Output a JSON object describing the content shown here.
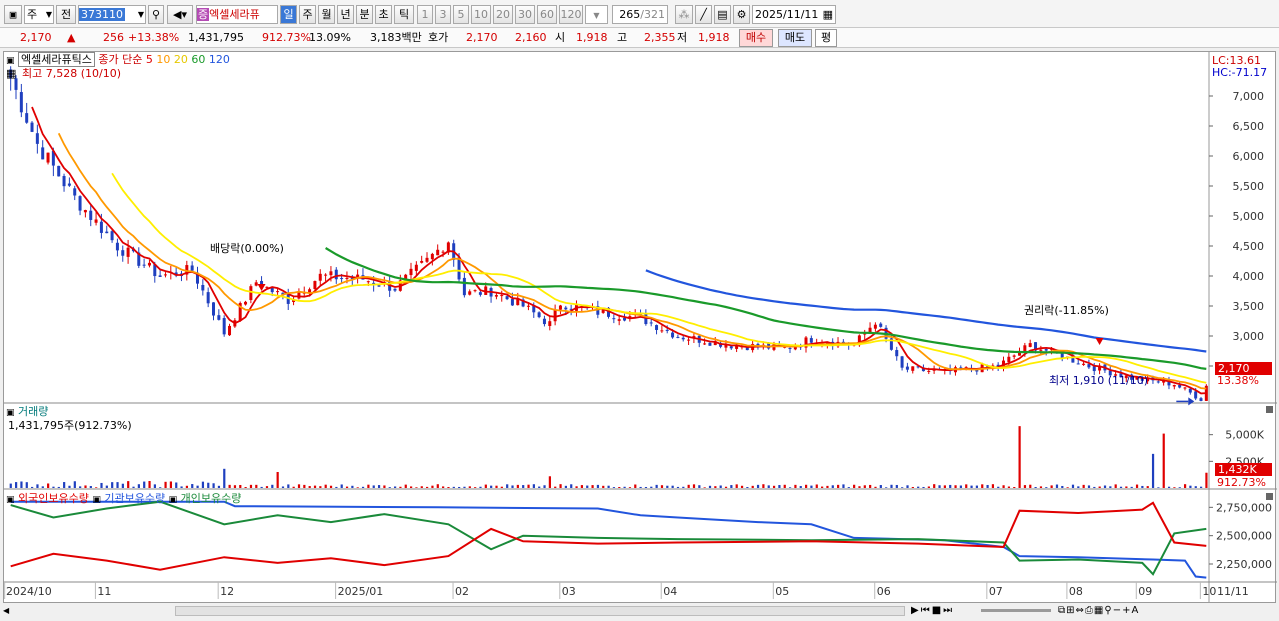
{
  "toolbar": {
    "period_select": "주",
    "prev_label": "전",
    "code": "373110",
    "stock_name": "엑셀세라퓨",
    "stock_tag": "증",
    "period_tabs": [
      "일",
      "주",
      "월",
      "년",
      "분",
      "초",
      "틱"
    ],
    "active_tab": "일",
    "interval_buttons": [
      "1",
      "3",
      "5",
      "10",
      "20",
      "30",
      "60",
      "120"
    ],
    "count_shown": "265",
    "count_total": "/321",
    "date": "2025/11/11"
  },
  "quote": {
    "price": "2,170",
    "change_arrow": "▲",
    "change": "256",
    "change_pct": "+13.38%",
    "volume": "1,431,795",
    "volume_ratio": "912.73%",
    "turnover": "13.09%",
    "amount": "3,183백만",
    "hoga_label": "호가",
    "ask": "2,170",
    "bid": "2,160",
    "open_label": "시",
    "open": "1,918",
    "high_label": "고",
    "high": "2,355",
    "low_label": "저",
    "low": "1,918",
    "buy_label": "매수",
    "sell_label": "매도",
    "eval_label": "평"
  },
  "chart_legend": {
    "name": "엑셀세라퓨틱스",
    "ma_label": "종가 단순",
    "ma_periods": [
      "5",
      "10",
      "20",
      "60",
      "120"
    ],
    "ma_colors": [
      "#e00000",
      "#ff9900",
      "#ffee00",
      "#1a9a2a",
      "#2255dd"
    ],
    "high_note": "최고 7,528 (10/10)",
    "low_note": "최저 1,910 (11/10)",
    "dividend_note": "배당락(0.00%)",
    "rights_note": "권리락(-11.85%)",
    "lc": "LC:13.61",
    "hc": "HC:-71.17",
    "last_price_tag": "2,170",
    "last_pct_tag": "13.38%"
  },
  "volume_panel": {
    "title": "거래량",
    "info": "1,431,795주(912.73%)",
    "last_tag": "1,432K",
    "last_pct": "912.73%"
  },
  "holdings_panel": {
    "legend": [
      "외국인보유수량",
      "기관보유수량",
      "개인보유수량"
    ],
    "colors": [
      "#e00000",
      "#2255dd",
      "#1a8a3a"
    ]
  },
  "x_axis": [
    "2024/10",
    "11",
    "12",
    "2025/01",
    "02",
    "03",
    "04",
    "05",
    "06",
    "07",
    "08",
    "09",
    "10",
    "11",
    "11/11"
  ],
  "colors": {
    "up": "#e00000",
    "down": "#1f3fbf",
    "axis_bg": "#ffffff",
    "active_tab": "#3a78d6"
  },
  "chart_data": [
    {
      "type": "candlestick",
      "title": "엑셀세라퓨틱스",
      "x_range": [
        "2024/10/08",
        "2025/11/11"
      ],
      "ylim": [
        1900,
        7600
      ],
      "y_ticks": [
        2500,
        3000,
        3500,
        4000,
        4500,
        5000,
        5500,
        6000,
        6500,
        7000
      ],
      "close_path": [
        [
          0,
          7300
        ],
        [
          5,
          6200
        ],
        [
          12,
          5300
        ],
        [
          20,
          4500
        ],
        [
          28,
          4000
        ],
        [
          34,
          4100
        ],
        [
          40,
          3050
        ],
        [
          46,
          3900
        ],
        [
          52,
          3600
        ],
        [
          58,
          4000
        ],
        [
          66,
          3950
        ],
        [
          72,
          3800
        ],
        [
          78,
          4250
        ],
        [
          82,
          4600
        ],
        [
          85,
          3700
        ],
        [
          90,
          3750
        ],
        [
          96,
          3500
        ],
        [
          101,
          3200
        ],
        [
          103,
          3550
        ],
        [
          110,
          3400
        ],
        [
          118,
          3300
        ],
        [
          125,
          3000
        ],
        [
          135,
          2850
        ],
        [
          145,
          2800
        ],
        [
          150,
          2950
        ],
        [
          158,
          2850
        ],
        [
          162,
          3250
        ],
        [
          167,
          2450
        ],
        [
          175,
          2400
        ],
        [
          185,
          2500
        ],
        [
          191,
          2850
        ],
        [
          196,
          2700
        ],
        [
          202,
          2500
        ],
        [
          210,
          2300
        ],
        [
          218,
          2200
        ],
        [
          223,
          1950
        ],
        [
          224,
          2170
        ]
      ],
      "series": [
        {
          "name": "5",
          "color": "#e00000"
        },
        {
          "name": "10",
          "color": "#ff9900"
        },
        {
          "name": "20",
          "color": "#ffee00"
        },
        {
          "name": "60",
          "color": "#1a9a2a"
        },
        {
          "name": "120",
          "color": "#2255dd"
        }
      ],
      "last": 2170,
      "high": {
        "value": 7528,
        "date": "10/10"
      },
      "low": {
        "value": 1910,
        "date": "11/10"
      }
    },
    {
      "type": "bar",
      "title": "거래량",
      "y_ticks": [
        "2,500K",
        "5,000K"
      ],
      "ylim": [
        0,
        6000000
      ],
      "spikes": [
        [
          40,
          1800000
        ],
        [
          50,
          1500000
        ],
        [
          101,
          1100000
        ],
        [
          189,
          5800000
        ],
        [
          214,
          3200000
        ],
        [
          216,
          5100000
        ],
        [
          224,
          1431795
        ]
      ]
    },
    {
      "type": "line",
      "title": "보유수량",
      "y_ticks": [
        "2,250,000",
        "2,500,000",
        "2,750,000"
      ],
      "ylim": [
        2100000,
        2850000
      ]
    }
  ]
}
